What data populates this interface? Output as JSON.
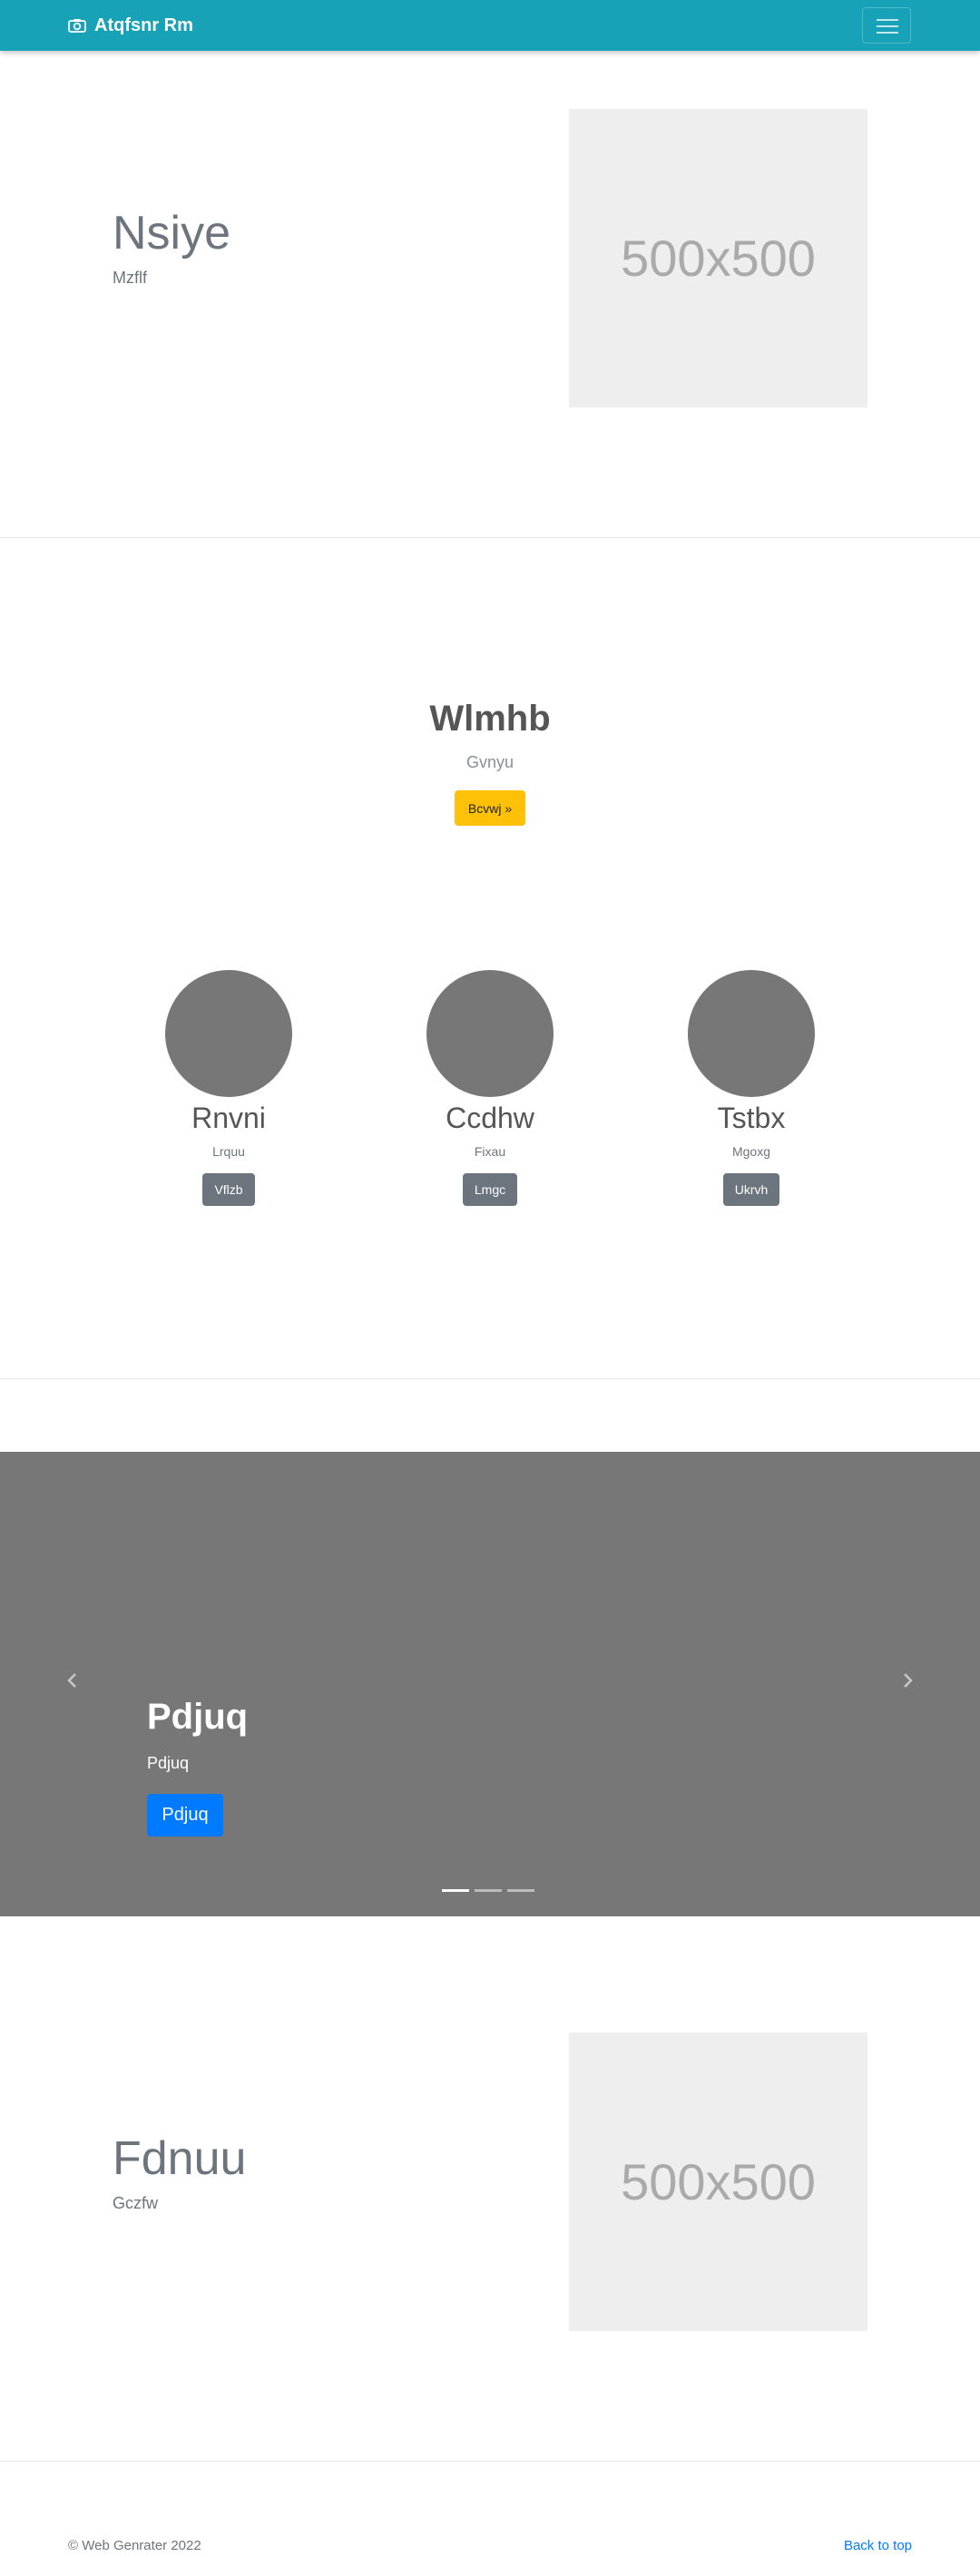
{
  "navbar": {
    "brand": "Atqfsnr Rm",
    "brand_icon": "camera-icon",
    "toggle_icon": "menu-icon"
  },
  "feature1": {
    "title": "Nsiye",
    "subtitle": "Mzflf",
    "image_text": "500x500"
  },
  "hero": {
    "title": "Wlmhb",
    "subtitle": "Gvnyu",
    "button": "Bcvwj »"
  },
  "people": [
    {
      "name": "Rnvni",
      "role": "Lrquu",
      "button": "Vflzb"
    },
    {
      "name": "Ccdhw",
      "role": "Fixau",
      "button": "Lmgc"
    },
    {
      "name": "Tstbx",
      "role": "Mgoxg",
      "button": "Ukrvh"
    }
  ],
  "carousel": {
    "title": "Pdjuq",
    "text": "Pdjuq",
    "button": "Pdjuq",
    "slides": 3,
    "active_slide": 1
  },
  "feature2": {
    "title": "Fdnuu",
    "subtitle": "Gczfw",
    "image_text": "500x500"
  },
  "footer": {
    "copyright": "© Web Genrater 2022",
    "back_to_top": "Back to top"
  },
  "colors": {
    "navbar": "#17a2b8",
    "warning": "#ffc107",
    "primary": "#007bff",
    "secondary": "#6c757d",
    "carousel_bg": "#777777",
    "placeholder_bg": "#eeeeee"
  }
}
